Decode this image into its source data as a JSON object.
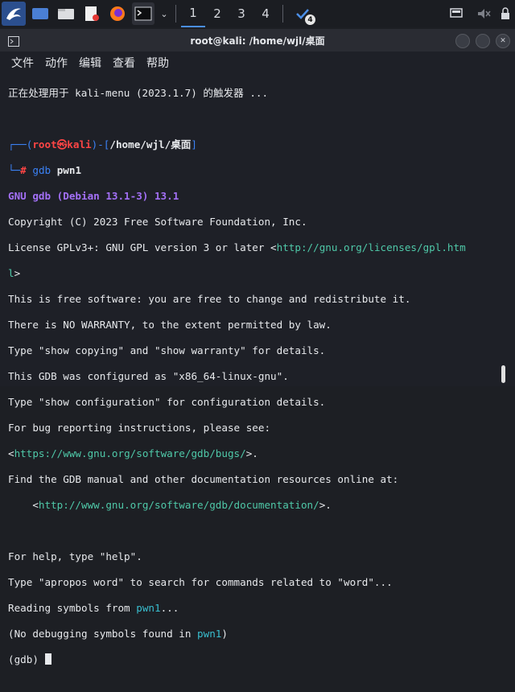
{
  "taskbar": {
    "workspaces": [
      "1",
      "2",
      "3",
      "4"
    ],
    "notification_count": "4"
  },
  "window": {
    "title": "root@kali: /home/wjl/桌面"
  },
  "menu": [
    "文件",
    "动作",
    "编辑",
    "查看",
    "帮助"
  ],
  "terminal": {
    "trigger_line": "正在处理用于 kali-menu (2023.1.7) 的触发器 ...",
    "prompt_user": "root",
    "prompt_skull": "㉿",
    "prompt_host": "kali",
    "prompt_path": "/home/wjl/桌面",
    "command_name": "gdb",
    "command_arg": "pwn1",
    "gdb_banner": "GNU gdb (Debian 13.1-3) 13.1",
    "copyright": "Copyright (C) 2023 Free Software Foundation, Inc.",
    "license_prefix": "License GPLv3+: GNU GPL version 3 or later <",
    "license_url": "http://gnu.org/licenses/gpl.htm",
    "license_url_tail": "l",
    "license_suffix": ">",
    "free_sw": "This is free software: you are free to change and redistribute it.",
    "no_warranty": "There is NO WARRANTY, to the extent permitted by law.",
    "show_copying": "Type \"show copying\" and \"show warranty\" for details.",
    "configured": "This GDB was configured as \"x86_64-linux-gnu\".",
    "show_config": "Type \"show configuration\" for configuration details.",
    "bug_report": "For bug reporting instructions, please see:",
    "bugs_url": "https://www.gnu.org/software/gdb/bugs/",
    "bugs_suffix": ">.",
    "find_manual": "Find the GDB manual and other documentation resources online at:",
    "doc_prefix": "    <",
    "doc_url": "http://www.gnu.org/software/gdb/documentation/",
    "doc_suffix": ">.",
    "help_line": "For help, type \"help\".",
    "apropos_line": "Type \"apropos word\" to search for commands related to \"word\"...",
    "reading_prefix": "Reading symbols from ",
    "reading_file": "pwn1",
    "reading_suffix": "...",
    "no_debug_prefix": "(No debugging symbols found in ",
    "no_debug_file": "pwn1",
    "no_debug_suffix": ")",
    "gdb_prompt": "(gdb) "
  },
  "colors": {
    "prompt_blue": "#3b82f6",
    "prompt_red": "#ff4545",
    "gdb_purple": "#a370f7",
    "link_teal": "#4fc8a8"
  }
}
